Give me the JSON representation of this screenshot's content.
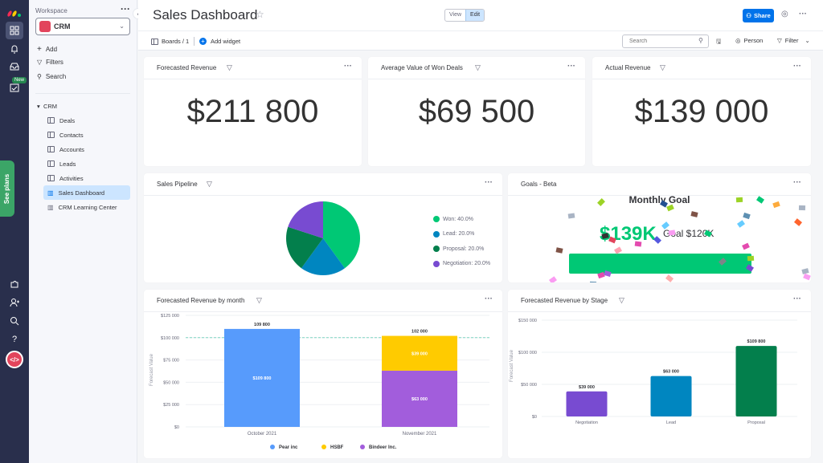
{
  "rail": {
    "icons": [
      "monday-logo-icon",
      "dashboard-icon",
      "bell-icon",
      "inbox-icon",
      "my-work-icon",
      "integrations-icon",
      "invite-icon",
      "search-icon",
      "help-icon"
    ],
    "new_badge": "New",
    "see_plans": "See plans",
    "avatar_initials": "</>"
  },
  "sidebar": {
    "workspace_label": "Workspace",
    "workspace_name": "CRM",
    "actions": [
      {
        "label": "Add",
        "icon": "plus-icon"
      },
      {
        "label": "Filters",
        "icon": "filter-icon"
      },
      {
        "label": "Search",
        "icon": "search-icon"
      }
    ],
    "group": "CRM",
    "items": [
      {
        "label": "Deals",
        "icon": "board-icon"
      },
      {
        "label": "Contacts",
        "icon": "board-icon"
      },
      {
        "label": "Accounts",
        "icon": "board-icon"
      },
      {
        "label": "Leads",
        "icon": "board-icon"
      },
      {
        "label": "Activities",
        "icon": "board-icon"
      },
      {
        "label": "Sales Dashboard",
        "icon": "dashboard-icon",
        "selected": true
      },
      {
        "label": "CRM Learning Center",
        "icon": "dashboard-icon"
      }
    ]
  },
  "header": {
    "title": "Sales Dashboard",
    "view_label": "View",
    "edit_label": "Edit",
    "share_label": "Share",
    "boards_label": "Boards / 1",
    "add_widget_label": "Add widget",
    "search_placeholder": "Search",
    "person_label": "Person",
    "filter_label": "Filter"
  },
  "widgets": {
    "forecasted_revenue": {
      "title": "Forecasted Revenue",
      "value": "$211 800"
    },
    "avg_won": {
      "title": "Average Value of Won Deals",
      "value": "$69 500"
    },
    "actual_revenue": {
      "title": "Actual Revenue",
      "value": "$139 000"
    },
    "pipeline": {
      "title": "Sales Pipeline"
    },
    "goals": {
      "title": "Goals - Beta",
      "heading": "Monthly Goal",
      "value": "$139K",
      "goal": "Goal $120K",
      "progress_percent": 100,
      "color": "#00c875"
    },
    "by_month": {
      "title": "Forecasted Revenue by month"
    },
    "by_stage": {
      "title": "Forecasted Revenue by Stage"
    }
  },
  "chart_data": [
    {
      "type": "pie",
      "title": "Sales Pipeline",
      "slices": [
        {
          "label": "Won",
          "value": 40.0,
          "color": "#00c875",
          "legend": "Won: 40.0%"
        },
        {
          "label": "Lead",
          "value": 20.0,
          "color": "#0086c0",
          "legend": "Lead: 20.0%"
        },
        {
          "label": "Proposal",
          "value": 20.0,
          "color": "#037f4c",
          "legend": "Proposal: 20.0%"
        },
        {
          "label": "Negotiation",
          "value": 20.0,
          "color": "#784bd1",
          "legend": "Negotiation: 20.0%"
        }
      ],
      "legend_position": "right"
    },
    {
      "type": "bar",
      "stacked": true,
      "title": "Forecasted Revenue by month",
      "categories": [
        "October 2021",
        "November 2021"
      ],
      "series": [
        {
          "name": "Pear inc",
          "color": "#579bfc",
          "values": [
            109800,
            0
          ],
          "labels": [
            "$109 800",
            ""
          ]
        },
        {
          "name": "Bindeer Inc.",
          "color": "#a25ddc",
          "values": [
            0,
            63000
          ],
          "labels": [
            "",
            "$63 000"
          ]
        },
        {
          "name": "HSBF",
          "color": "#ffcb00",
          "values": [
            0,
            39000
          ],
          "labels": [
            "",
            "$39 000"
          ]
        }
      ],
      "totals": [
        "109 800",
        "102 000"
      ],
      "legend_order": [
        "Pear inc",
        "HSBF",
        "Bindeer Inc."
      ],
      "ylabel": "Forecast Value",
      "ylim": [
        0,
        125000
      ],
      "yticks": [
        "$0",
        "$25 000",
        "$50 000",
        "$75 000",
        "$100 000",
        "$125 000"
      ],
      "goal_line": 100000,
      "legend_position": "bottom"
    },
    {
      "type": "bar",
      "title": "Forecasted Revenue by Stage",
      "categories": [
        "Negotiation",
        "Lead",
        "Proposal"
      ],
      "values": [
        39000,
        63000,
        109800
      ],
      "labels": [
        "$39 000",
        "$63 000",
        "$109 800"
      ],
      "colors": [
        "#784bd1",
        "#0086c0",
        "#037f4c"
      ],
      "ylabel": "Forecast Value",
      "ylim": [
        0,
        150000
      ],
      "yticks": [
        "$0",
        "$50 000",
        "$100 000",
        "$150 000"
      ]
    }
  ]
}
